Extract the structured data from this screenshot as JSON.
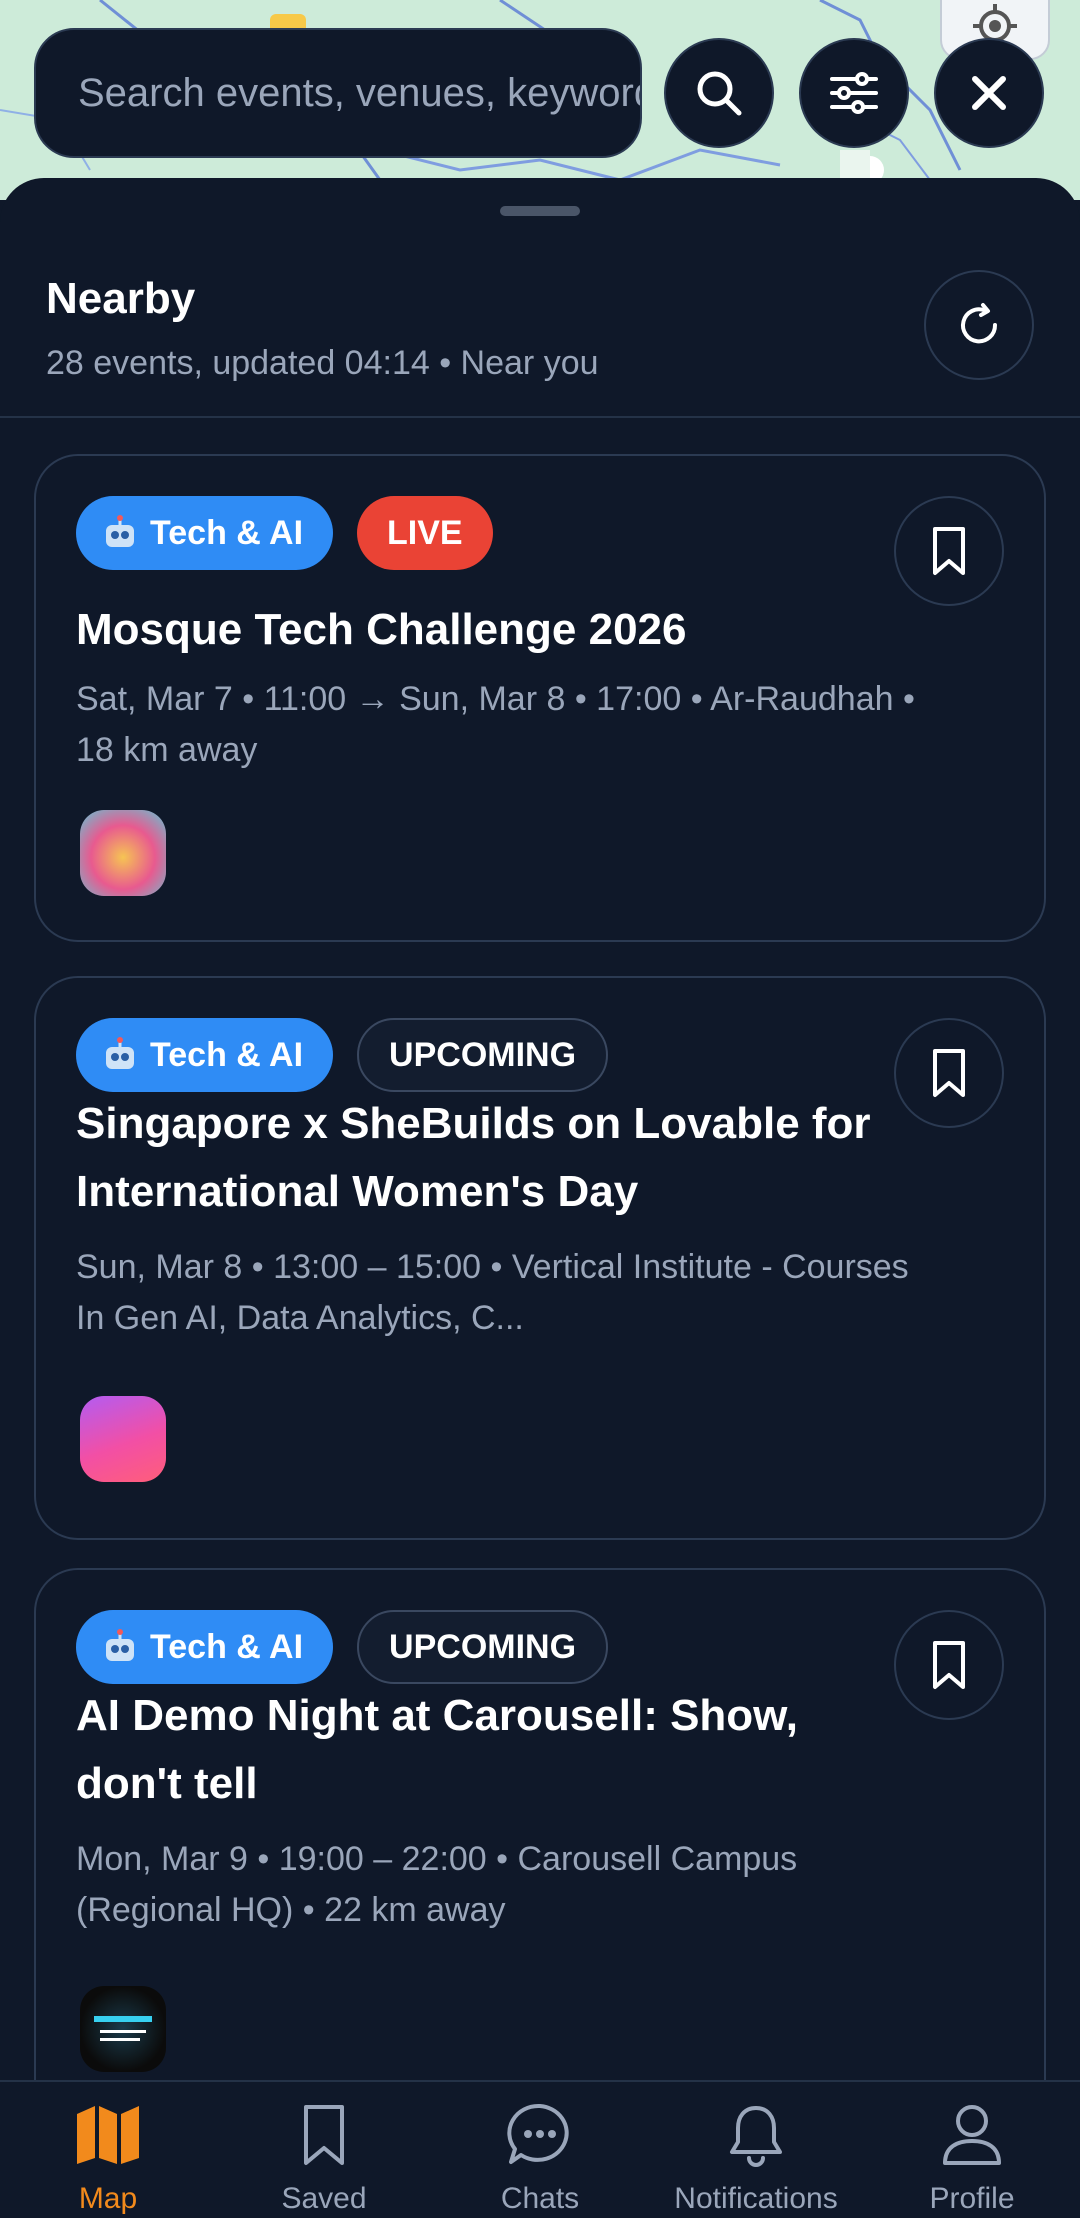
{
  "search": {
    "placeholder": "Search events, venues, keywords"
  },
  "header": {
    "title": "Nearby",
    "subtitle": "28 events, updated 04:14 • Near you"
  },
  "events": [
    {
      "category": "Tech & AI",
      "status": "LIVE",
      "title": "Mosque Tech Challenge 2026",
      "meta": "Sat, Mar 7 • 11:00 → Sun, Mar 8 • 17:00 • Ar-Raudhah • 18 km away",
      "thumb_colors": [
        "#f6c453",
        "#e85a8f",
        "#5ec7d6"
      ]
    },
    {
      "category": "Tech & AI",
      "status": "UPCOMING",
      "title": "Singapore x SheBuilds on Lovable for International Women's Day",
      "meta": "Sun, Mar 8 • 13:00 – 15:00 • Vertical Institute - Courses In Gen AI, Data Analytics, C...",
      "thumb_colors": [
        "#f24fa5",
        "#e85fd4",
        "#ff5e7a"
      ]
    },
    {
      "category": "Tech & AI",
      "status": "UPCOMING",
      "title": "AI Demo Night at Carousell: Show, don't tell",
      "meta": "Mon, Mar 9 • 19:00 – 22:00 • Carousell Campus (Regional HQ) • 22 km away",
      "thumb_colors": [
        "#0b0b0b",
        "#37d0f0",
        "#ffffff"
      ]
    }
  ],
  "nav": [
    {
      "label": "Map",
      "icon": "map-icon",
      "active": true
    },
    {
      "label": "Saved",
      "icon": "bookmark-icon",
      "active": false
    },
    {
      "label": "Chats",
      "icon": "chat-icon",
      "active": false
    },
    {
      "label": "Notifications",
      "icon": "bell-icon",
      "active": false
    },
    {
      "label": "Profile",
      "icon": "person-icon",
      "active": false
    }
  ],
  "colors": {
    "background": "#0f1829",
    "accent_active": "#f28a1c",
    "category_chip": "#2f8cf5",
    "live_chip": "#ea4335",
    "muted_text": "#9aa6ba"
  }
}
